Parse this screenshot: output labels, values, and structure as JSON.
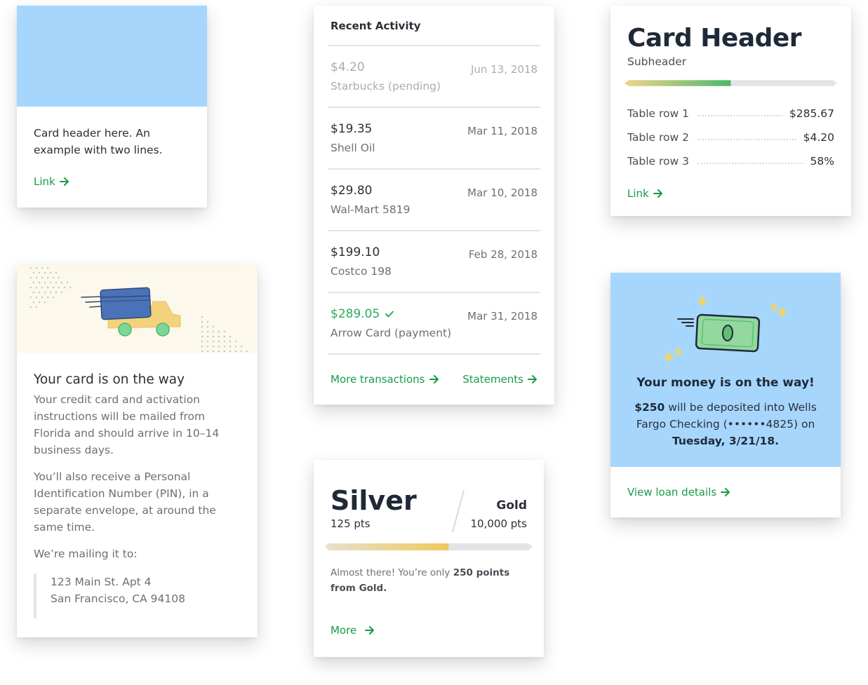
{
  "card_a": {
    "text": "Card header here. An example with two lines.",
    "link": "Link"
  },
  "activity": {
    "title": "Recent Activity",
    "rows": [
      {
        "amount": "$4.20",
        "date": "Jun 13, 2018",
        "merchant": "Starbucks (pending)"
      },
      {
        "amount": "$19.35",
        "date": "Mar 11, 2018",
        "merchant": "Shell Oil"
      },
      {
        "amount": "$29.80",
        "date": "Mar 10, 2018",
        "merchant": "Wal-Mart 5819"
      },
      {
        "amount": "$199.10",
        "date": "Feb 28, 2018",
        "merchant": "Costco 198"
      },
      {
        "amount": "$289.05",
        "date": "Mar 31, 2018",
        "merchant": "Arrow Card (payment)"
      }
    ],
    "more_link": "More transactions",
    "statements_link": "Statements"
  },
  "header_card": {
    "title": "Card Header",
    "subtitle": "Subheader",
    "progress": 0.5,
    "rows": [
      {
        "label": "Table row 1",
        "value": "$285.67"
      },
      {
        "label": "Table row 2",
        "value": "$4.20"
      },
      {
        "label": "Table row 3",
        "value": "58%"
      }
    ],
    "link": "Link"
  },
  "shipping": {
    "title": "Your card is on the way",
    "p1": "Your credit card and activation instructions will be mailed from Florida and should arrive in 10–14 business days.",
    "p2": "You’ll also receive a Personal Identification Number (PIN), in a separate envelope, at around the same time.",
    "p3": "We’re mailing it to:",
    "address_line1": "123 Main St. Apt 4",
    "address_line2": "San Francisco, CA 94108"
  },
  "rewards": {
    "level": "Silver",
    "level_pts": "125 pts",
    "next_level": "Gold",
    "next_pts": "10,000 pts",
    "progress": 0.6,
    "msg_prefix": "Almost there! You’re only ",
    "msg_bold": "250 points from Gold.",
    "link": "More"
  },
  "money": {
    "title": "Your money is on the way!",
    "amount": "$250",
    "desc_mid": " will be deposited into Wells Fargo Checking (••••••4825) on ",
    "date": "Tuesday, 3/21/18.",
    "link": "View loan details"
  },
  "colors": {
    "accent_green": "#1a9a47",
    "hero_blue": "#a7d6fd",
    "hero_cream": "#fdf8ec"
  },
  "icons": [
    "arrow-right-icon",
    "check-icon",
    "truck-illustration",
    "money-illustration"
  ]
}
